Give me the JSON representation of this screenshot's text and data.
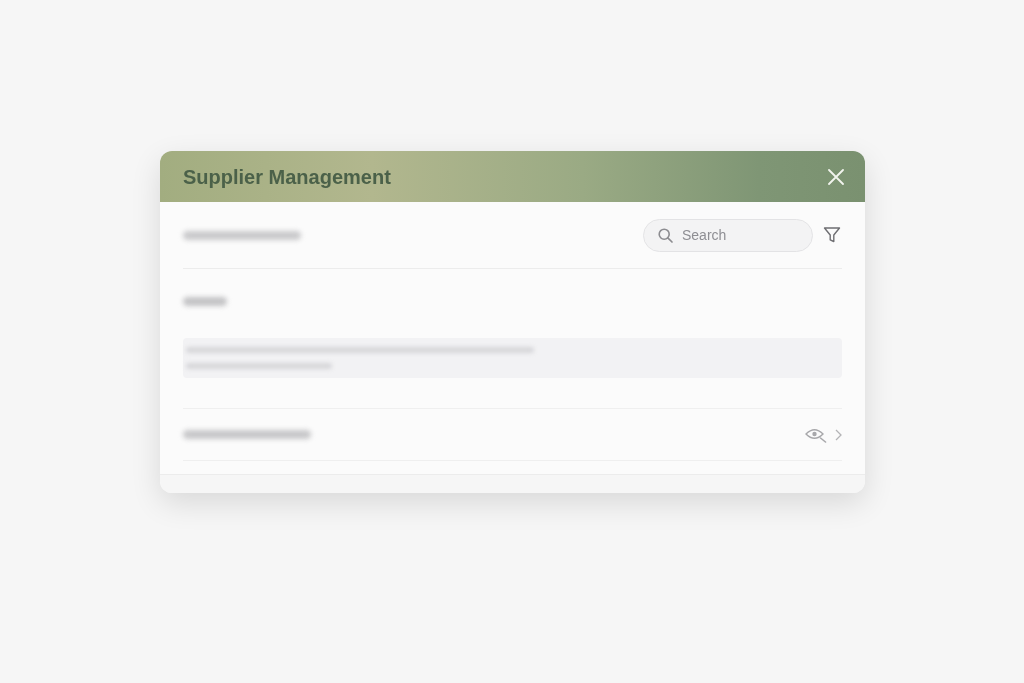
{
  "window": {
    "title": "Supplier Management"
  },
  "search": {
    "placeholder": "Search"
  }
}
